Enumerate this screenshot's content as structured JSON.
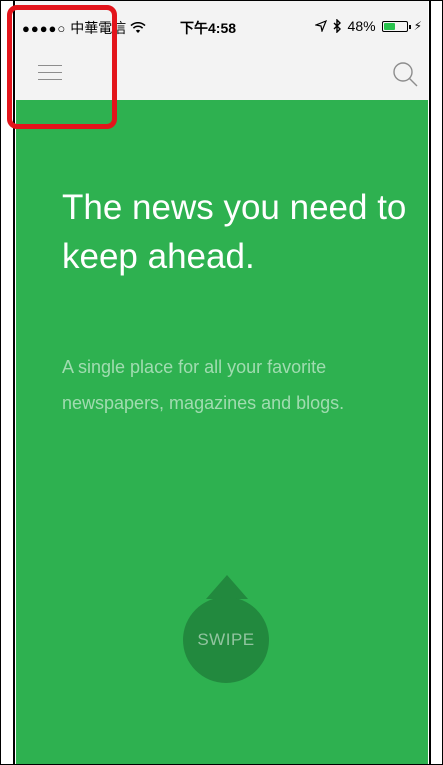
{
  "status_bar": {
    "signal": "●●●●○",
    "carrier": "中華電信",
    "time": "下午4:58",
    "location_icon": "location-arrow-icon",
    "bluetooth_icon": "bluetooth-icon",
    "battery_percent": "48%",
    "battery_level": 0.48
  },
  "nav_bar": {
    "menu_icon": "hamburger-menu-icon",
    "search_icon": "search-icon"
  },
  "hero": {
    "headline": "The news you need to keep ahead.",
    "subtitle": "A single place for all your favorite newspapers, magazines and blogs."
  },
  "swipe": {
    "label": "SWIPE"
  },
  "colors": {
    "background_green": "#2eb150",
    "swipe_dark_green": "#22893e",
    "highlight_red": "#e3141b",
    "bar_gray": "#f3f3f3"
  }
}
